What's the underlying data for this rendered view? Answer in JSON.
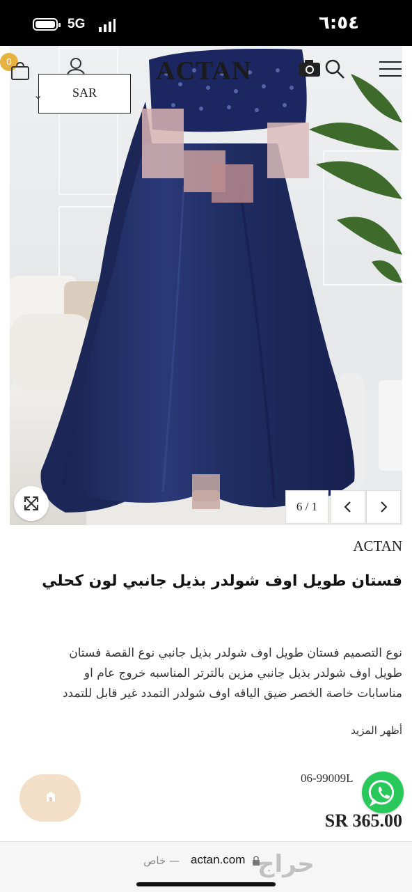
{
  "status_bar": {
    "time": "٦:٥٤",
    "network": "5G"
  },
  "header": {
    "brand": "ACTAN",
    "cart_count": "0",
    "currency": "SAR"
  },
  "gallery": {
    "counter": "6 / 1"
  },
  "product": {
    "vendor": "ACTAN",
    "title": "فستان طويل اوف شولدر بذيل جانبي لون كحلي",
    "description_lines": [
      "نوع التصميم فستان طويل اوف شولدر بذيل جانبي نوع القصة فستان",
      "طويل اوف شولدر بذيل جانبي مزين بالترتر  المناسبه خروج عام او",
      "مناسابات خاصة الخصر ضيق الياقه اوف شولدر التمدد غير قابل للتمدد"
    ],
    "show_more": "أظهر المزيد",
    "sku": "06-99009L",
    "price": "SR 365.00"
  },
  "browser": {
    "url": "actan.com",
    "private_label": "— خاص",
    "watermark": "حراج"
  },
  "colors": {
    "dress_navy": "#1f2c5e",
    "badge": "#e7b340",
    "whatsapp": "#28c85a",
    "chat_button": "#f3dfc8"
  }
}
